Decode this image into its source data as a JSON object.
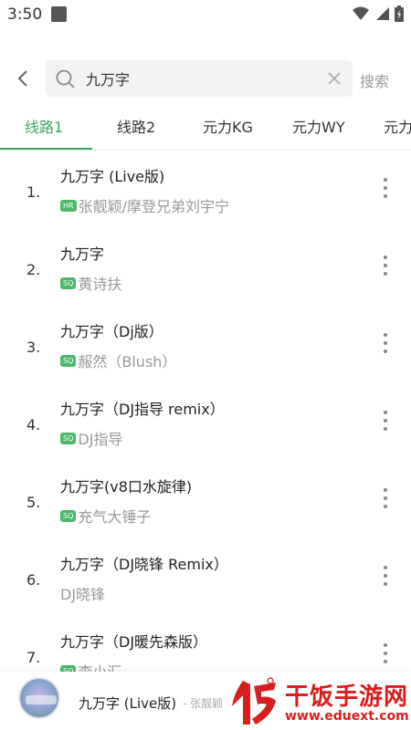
{
  "status_bar": {
    "time": "3:50",
    "icons": [
      "wifi-icon",
      "signal-icon",
      "battery-icon"
    ]
  },
  "search": {
    "query": "九万字",
    "submit_label": "搜索"
  },
  "tabs": [
    {
      "label": "线路1",
      "active": true
    },
    {
      "label": "线路2",
      "active": false
    },
    {
      "label": "元力KG",
      "active": false
    },
    {
      "label": "元力WY",
      "active": false
    },
    {
      "label": "元力",
      "active": false
    }
  ],
  "songs": [
    {
      "num": "1.",
      "title": "九万字 (Live版)",
      "quality": "HR",
      "artist": "张靓颖/摩登兄弟刘宇宁"
    },
    {
      "num": "2.",
      "title": "九万字",
      "quality": "SQ",
      "artist": "黄诗扶"
    },
    {
      "num": "3.",
      "title": "九万字（Dj版）",
      "quality": "SQ",
      "artist": "赧然（Blush）"
    },
    {
      "num": "4.",
      "title": "九万字（DJ指导 remix）",
      "quality": "SQ",
      "artist": "DJ指导"
    },
    {
      "num": "5.",
      "title": "九万字(v8口水旋律)",
      "quality": "SQ",
      "artist": "充气大锤子"
    },
    {
      "num": "6.",
      "title": "九万字（DJ晓锋 Remix）",
      "quality": "",
      "artist": "DJ晓锋"
    },
    {
      "num": "7.",
      "title": "九万字（DJ暖先森版）",
      "quality": "SQ",
      "artist": "李小汇"
    }
  ],
  "player": {
    "title": "九万字 (Live版)",
    "artist": "- 张靓颖"
  },
  "watermark": {
    "title": "干饭手游网",
    "url": "www.eduext.com"
  },
  "colors": {
    "accent": "#3aa861",
    "badge": "#4cb86a",
    "watermark": "#d81e1e"
  }
}
